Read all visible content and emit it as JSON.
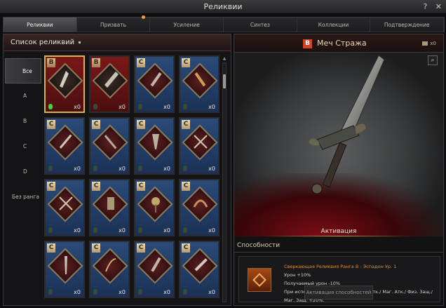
{
  "window": {
    "title": "Реликвии",
    "help_icon": "?",
    "close_icon": "✕"
  },
  "tabs": [
    {
      "label": "Реликвии",
      "active": true
    },
    {
      "label": "Призвать",
      "active": false,
      "notify": true
    },
    {
      "label": "Усиление",
      "active": false
    },
    {
      "label": "Синтез",
      "active": false
    },
    {
      "label": "Коллекции",
      "active": false
    },
    {
      "label": "Подтверждение",
      "active": false
    }
  ],
  "list": {
    "title": "Список реликвий",
    "filters": [
      "Все",
      "A",
      "B",
      "C",
      "D",
      "Без ранга"
    ],
    "active_filter": "Все",
    "cards": [
      {
        "rank": "B",
        "count": "x0",
        "selected": true,
        "gem": true
      },
      {
        "rank": "B",
        "count": "x0"
      },
      {
        "rank": "C",
        "count": "x0"
      },
      {
        "rank": "C",
        "count": "x0"
      },
      {
        "rank": "C",
        "count": "x0"
      },
      {
        "rank": "C",
        "count": "x0"
      },
      {
        "rank": "C",
        "count": "x0"
      },
      {
        "rank": "C",
        "count": "x0"
      },
      {
        "rank": "C",
        "count": "x0"
      },
      {
        "rank": "C",
        "count": "x0"
      },
      {
        "rank": "C",
        "count": "x0"
      },
      {
        "rank": "C",
        "count": "x0"
      },
      {
        "rank": "C",
        "count": "x0"
      },
      {
        "rank": "C",
        "count": "x0"
      },
      {
        "rank": "C",
        "count": "x0"
      },
      {
        "rank": "C",
        "count": "x0"
      }
    ]
  },
  "detail": {
    "rank": "B",
    "name": "Меч Стража",
    "count": "x0",
    "activation_label": "Активация",
    "abilities_title": "Способности",
    "ability": {
      "title": "Сверкающая Реликвия Ранга B - Эспадон Ур. 1",
      "line1": "Урон +10%",
      "line2": "Получаемый урон -10%",
      "line3": "При использовании Эспадона Физ. Атк./ Маг. Атк./ Физ. Защ./ Маг. Защ. +20%."
    },
    "activate_button": "Активация способностей"
  },
  "colors": {
    "rank_b": "#7a1818",
    "rank_c": "#2a4a78",
    "accent": "#d9b24e"
  }
}
